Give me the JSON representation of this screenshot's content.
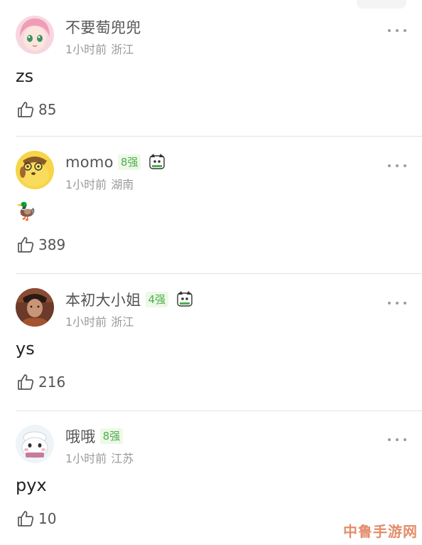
{
  "comments": [
    {
      "username": "不要萄兜兜",
      "badge": "",
      "time": "1小时前",
      "location": "浙江",
      "content": "zs",
      "likes": "85",
      "avatar": "anime-girl-avatar"
    },
    {
      "username": "momo",
      "badge": "8强",
      "time": "1小时前",
      "location": "湖南",
      "content": "🦆",
      "likes": "389",
      "avatar": "pompompurin-avatar"
    },
    {
      "username": "本初大小姐",
      "badge": "4强",
      "time": "1小时前",
      "location": "浙江",
      "content": "ys",
      "likes": "216",
      "avatar": "photo-avatar"
    },
    {
      "username": "哦哦",
      "badge": "8强",
      "time": "1小时前",
      "location": "江苏",
      "content": "pyx",
      "likes": "10",
      "avatar": "cartoon-sheep-avatar"
    }
  ],
  "watermark": "中鲁手游网",
  "colors": {
    "badge_text": "#4caf50",
    "badge_bg": "#eef8e7",
    "meta": "#9a9a9a",
    "divider": "#e3e3e3"
  }
}
